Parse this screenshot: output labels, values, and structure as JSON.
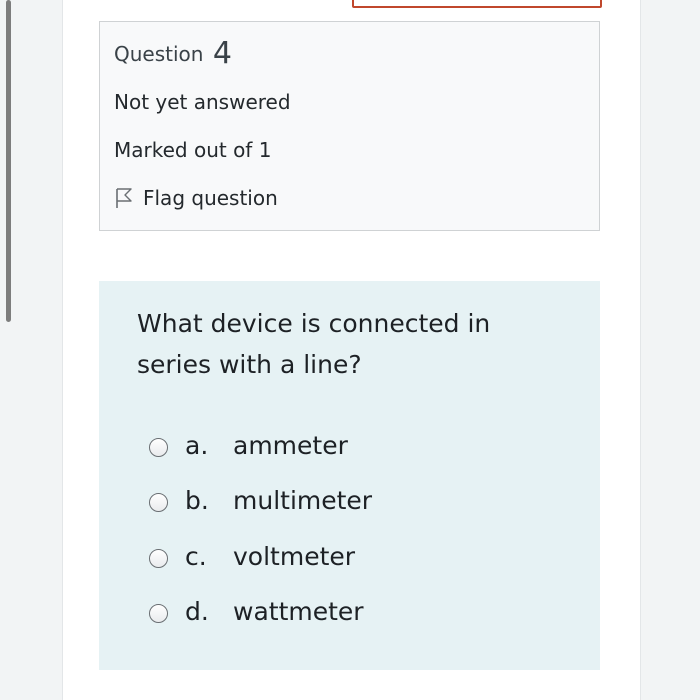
{
  "question_info": {
    "title_prefix": "Question",
    "number": "4",
    "state": "Not yet answered",
    "grade": "Marked out of 1",
    "flag_label": "Flag question",
    "flag_icon": "flag-outline-icon"
  },
  "question": {
    "text": "What device is connected in series with a line?",
    "options": [
      {
        "letter": "a.",
        "label": "ammeter"
      },
      {
        "letter": "b.",
        "label": "multimeter"
      },
      {
        "letter": "c.",
        "label": "voltmeter"
      },
      {
        "letter": "d.",
        "label": "wattmeter"
      }
    ]
  },
  "colors": {
    "content_bg": "#e6f2f4",
    "info_bg": "#f8f9fa",
    "top_box_border": "#c0472c"
  }
}
